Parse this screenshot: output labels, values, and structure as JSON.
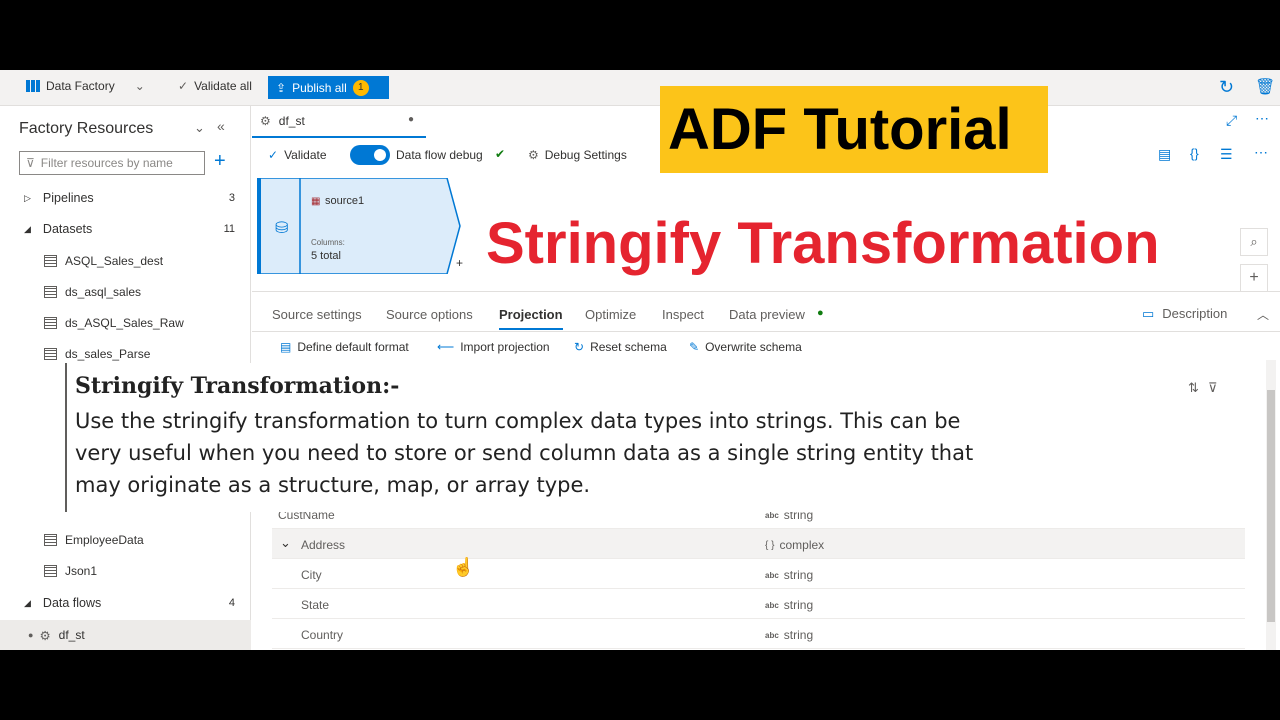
{
  "overlay": {
    "badge_title": "ADF Tutorial",
    "big_title": "Stringify Transformation",
    "note_heading": "Stringify Transformation:-",
    "note_body": "Use the stringify transformation to turn complex data types into strings. This can be very useful when you need to store or send column data as a single string entity that may originate as a structure, map, or array type."
  },
  "toolbar": {
    "factory": "Data Factory",
    "validate_all": "Validate all",
    "publish_all": "Publish all",
    "publish_count": "1"
  },
  "sidebar": {
    "title": "Factory Resources",
    "filter_placeholder": "Filter resources by name",
    "pipelines": {
      "label": "Pipelines",
      "count": "3"
    },
    "datasets": {
      "label": "Datasets",
      "count": "11"
    },
    "dataset_items": [
      "ASQL_Sales_dest",
      "ds_asql_sales",
      "ds_ASQL_Sales_Raw",
      "ds_sales_Parse",
      "EmployeeData",
      "Json1"
    ],
    "dataflows": {
      "label": "Data flows",
      "count": "4"
    },
    "dataflow_item": "df_st"
  },
  "editor": {
    "tab": "df_st",
    "validate": "Validate",
    "debug": "Data flow debug",
    "debug_settings": "Debug Settings",
    "node_name": "source1",
    "node_columns_label": "Columns:",
    "node_columns_value": "5 total"
  },
  "subtabs": [
    "Source settings",
    "Source options",
    "Projection",
    "Optimize",
    "Inspect",
    "Data preview"
  ],
  "description": "Description",
  "actions": [
    "Define default format",
    "Import projection",
    "Reset schema",
    "Overwrite schema"
  ],
  "rows": [
    {
      "name": "CustName",
      "type": "string",
      "abc": "abc"
    },
    {
      "name": "Address",
      "type": "complex",
      "abc": "{ }"
    },
    {
      "name": "City",
      "type": "string",
      "abc": "abc"
    },
    {
      "name": "State",
      "type": "string",
      "abc": "abc"
    },
    {
      "name": "Country",
      "type": "string",
      "abc": "abc"
    }
  ]
}
